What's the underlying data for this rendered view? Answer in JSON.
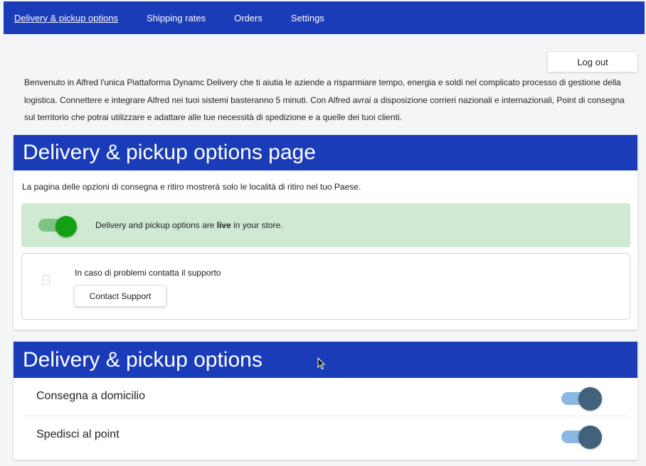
{
  "nav": {
    "items": [
      {
        "label": "Delivery & pickup options",
        "active": true
      },
      {
        "label": "Shipping rates",
        "active": false
      },
      {
        "label": "Orders",
        "active": false
      },
      {
        "label": "Settings",
        "active": false
      }
    ]
  },
  "header": {
    "logout_label": "Log out"
  },
  "intro_text": "Benvenuto in Alfred l'unica Piattaforma Dynamc Delivery che ti aiutia le aziende a risparmiare tempo, energia e soldi nel complicato processo di gestione della logistica. Connettere e integrare Alfred nei tuoi sistemi basteranno 5 minuti. Con Alfred avrai a disposizione corrieri nazionali e internazionali, Point di consegna sul territorio che potrai utilizzare e adattare alle tue necessità di spedizione e a quelle dei tuoi clienti.",
  "options_page": {
    "title": "Delivery & pickup options page",
    "description": "La pagina delle opzioni di consegna e ritiro mostrerà solo le località di ritiro nel tuo Paese.",
    "banner": {
      "text_before": "Delivery and pickup options are ",
      "text_bold": "live",
      "text_after": " in your store.",
      "toggle_on": true
    },
    "support": {
      "text": "In caso di problemi contatta il supporto",
      "button_label": "Contact Support"
    }
  },
  "options": {
    "title": "Delivery & pickup options",
    "rows": [
      {
        "label": "Consegna a domicilio",
        "enabled": true
      },
      {
        "label": "Spedisci al point",
        "enabled": true
      }
    ]
  },
  "colors": {
    "brand_blue": "#1a3cb8",
    "live_banner": "#cfe9d2",
    "live_toggle": "#14a014",
    "option_toggle_knob": "#40627c",
    "option_toggle_track": "#8ab8e2"
  }
}
